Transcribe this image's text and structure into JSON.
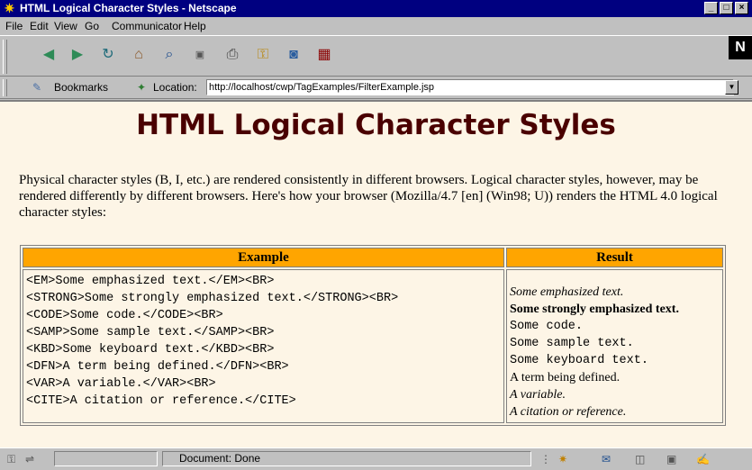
{
  "window": {
    "title": "HTML Logical Character Styles - Netscape"
  },
  "menu": [
    "File",
    "Edit",
    "View",
    "Go",
    "Communicator",
    "Help"
  ],
  "toolbar": {
    "icons": [
      "back-icon",
      "forward-icon",
      "reload-icon",
      "home-icon",
      "search-icon",
      "my-netscape-icon",
      "print-icon",
      "security-icon",
      "shop-icon",
      "stop-icon"
    ]
  },
  "location": {
    "bookmarks_label": "Bookmarks",
    "location_label": "Location:",
    "url": "http://localhost/cwp/TagExamples/FilterExample.jsp"
  },
  "page": {
    "heading": "HTML Logical Character Styles",
    "intro": "Physical character styles (B, I, etc.) are rendered consistently in different browsers. Logical character styles, however, may be rendered differently by different browsers. Here's how your browser (Mozilla/4.7 [en] (Win98; U)) renders the HTML 4.0 logical character styles:",
    "table": {
      "headers": [
        "Example",
        "Result"
      ],
      "example_lines": [
        "<EM>Some emphasized text.</EM><BR>",
        "<STRONG>Some strongly emphasized text.</STRONG><BR>",
        "<CODE>Some code.</CODE><BR>",
        "<SAMP>Some sample text.</SAMP><BR>",
        "<KBD>Some keyboard text.</KBD><BR>",
        "<DFN>A term being defined.</DFN><BR>",
        "<VAR>A variable.</VAR><BR>",
        "<CITE>A citation or reference.</CITE>"
      ],
      "result_lines": [
        "Some emphasized text.",
        "Some strongly emphasized text.",
        "Some code.",
        "Some sample text.",
        "Some keyboard text.",
        "A term being defined.",
        "A variable.",
        "A citation or reference."
      ]
    }
  },
  "status": {
    "text": "Document: Done"
  },
  "colors": {
    "heading": "#4a0000",
    "table_header": "#ffa500",
    "page_bg": "#fdf5e6",
    "titlebar": "#000080"
  }
}
